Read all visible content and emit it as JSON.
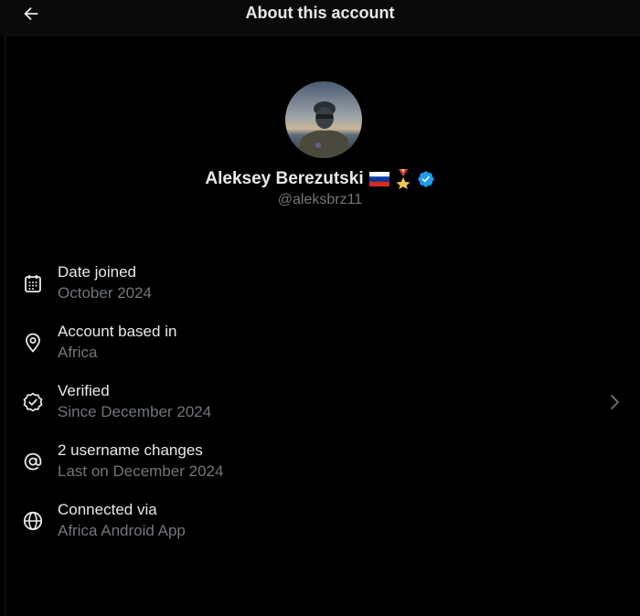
{
  "header": {
    "title": "About this account",
    "back_icon": "arrow-left-icon"
  },
  "profile": {
    "display_name": "Aleksey Berezutski",
    "emoji_flag": "🇷🇺",
    "emoji_medal": "🎖",
    "verified_icon": "verified-badge-icon",
    "handle": "@aleksbrz11"
  },
  "info": [
    {
      "icon": "calendar-icon",
      "label": "Date joined",
      "value": "October 2024"
    },
    {
      "icon": "location-pin-icon",
      "label": "Account based in",
      "value": "Africa"
    },
    {
      "icon": "verified-check-icon",
      "label": "Verified",
      "value": "Since December 2024",
      "chevron_icon": "chevron-right-icon"
    },
    {
      "icon": "at-sign-icon",
      "label": "2 username changes",
      "value": "Last on December 2024"
    },
    {
      "icon": "globe-icon",
      "label": "Connected via",
      "value": "Africa Android App"
    }
  ],
  "colors": {
    "background": "#000000",
    "header_bg": "#0a0a0a",
    "primary_text": "#e7e9ea",
    "secondary_text": "#71767b",
    "verified_blue": "#1d9bf0"
  }
}
